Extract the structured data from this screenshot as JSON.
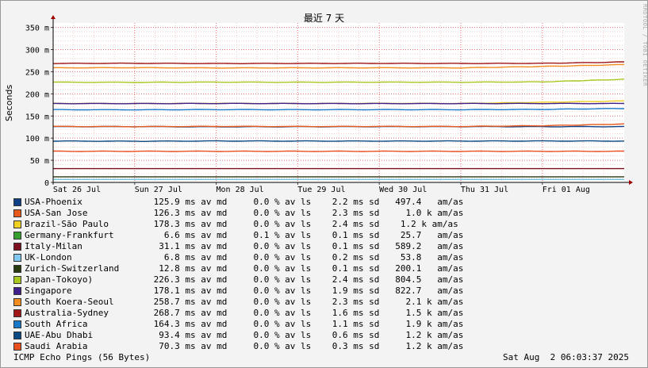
{
  "chart_data": {
    "type": "line",
    "title": "最近 7 天",
    "ylabel": "Seconds",
    "yunit": "m",
    "ylim": [
      0,
      360
    ],
    "yticks": [
      0,
      50,
      100,
      150,
      200,
      250,
      300,
      350
    ],
    "ytick_labels": [
      "0",
      "50 m",
      "100 m",
      "150 m",
      "200 m",
      "250 m",
      "300 m",
      "350 m"
    ],
    "x_categories": [
      "Sat 26 Jul",
      "Sun 27 Jul",
      "Mon 28 Jul",
      "Tue 29 Jul",
      "Wed 30 Jul",
      "Thu 31 Jul",
      "Fri 01 Aug"
    ],
    "grid": true,
    "series": [
      {
        "name": "USA-Phoenix",
        "color": "#0f3f86",
        "values": [
          125.9,
          126,
          125.5,
          125.8,
          125.9,
          126,
          125.9,
          126
        ]
      },
      {
        "name": "USA-San Jose",
        "color": "#e85a1c",
        "values": [
          126.3,
          126,
          126.5,
          126.2,
          126.4,
          126.3,
          128,
          132
        ]
      },
      {
        "name": "Brazil-São Paulo",
        "color": "#f0d020",
        "values": [
          178.3,
          178,
          178.5,
          178,
          178.4,
          178.2,
          181,
          184
        ]
      },
      {
        "name": "Germany-Frankfurt",
        "color": "#35a030",
        "values": [
          6.6,
          6.6,
          6.6,
          6.6,
          6.6,
          6.6,
          6.6,
          6.6
        ]
      },
      {
        "name": "Italy-Milan",
        "color": "#7a1020",
        "values": [
          31.1,
          31.1,
          31.1,
          31.1,
          31.1,
          31.1,
          31.1,
          31.1
        ]
      },
      {
        "name": "UK-London",
        "color": "#80c8f0",
        "values": [
          6.8,
          6.8,
          6.8,
          6.8,
          6.8,
          6.8,
          6.8,
          6.8
        ]
      },
      {
        "name": "Zurich-Switzerland",
        "color": "#2a3a10",
        "values": [
          12.8,
          12.8,
          12.8,
          12.8,
          12.8,
          12.8,
          12.8,
          12.8
        ]
      },
      {
        "name": "Japan-Tokoyo)",
        "color": "#a8c820",
        "values": [
          226.3,
          226,
          226.5,
          226.2,
          226.4,
          226.3,
          227,
          233
        ]
      },
      {
        "name": "Singapore",
        "color": "#40208a",
        "values": [
          178.1,
          178,
          178.2,
          178.1,
          178,
          178.1,
          178.2,
          178.1
        ]
      },
      {
        "name": "South Koera-Seoul",
        "color": "#f08c20",
        "values": [
          258.7,
          259,
          258.5,
          258.7,
          258.8,
          258.6,
          262,
          266
        ]
      },
      {
        "name": "Australia-Sydney",
        "color": "#a01818",
        "values": [
          268.7,
          269,
          268.5,
          268.7,
          268.8,
          268.6,
          268.9,
          272
        ]
      },
      {
        "name": "South Africa",
        "color": "#1878c8",
        "values": [
          164.3,
          164,
          164.5,
          164.2,
          164.4,
          164.3,
          165,
          167
        ]
      },
      {
        "name": "UAE-Abu Dhabi",
        "color": "#0a4a80",
        "values": [
          93.4,
          93,
          93.5,
          93.4,
          93.3,
          93.4,
          93.5,
          93.4
        ]
      },
      {
        "name": "Saudi Arabia",
        "color": "#e85020",
        "values": [
          70.3,
          70.3,
          70.3,
          70.3,
          70.3,
          70.3,
          70.3,
          70.3
        ]
      }
    ]
  },
  "legend": [
    {
      "name": "USA-Phoenix",
      "color": "#0f3f86",
      "stats": "125.9 ms av md     0.0 % av ls    2.2 ms sd   497.4   am/as"
    },
    {
      "name": "USA-San Jose",
      "color": "#e85a1c",
      "stats": "126.3 ms av md     0.0 % av ls    2.3 ms sd     1.0 k am/as"
    },
    {
      "name": "Brazil-São Paulo",
      "color": "#f0d020",
      "stats": "178.3 ms av md     0.0 % av ls    2.4 ms sd    1.2 k am/as"
    },
    {
      "name": "Germany-Frankfurt",
      "color": "#35a030",
      "stats": "6.6 ms av md     0.1 % av ls    0.1 ms sd    25.7   am/as"
    },
    {
      "name": "Italy-Milan",
      "color": "#7a1020",
      "stats": "31.1 ms av md     0.0 % av ls    0.1 ms sd   589.2   am/as"
    },
    {
      "name": "UK-London",
      "color": "#80c8f0",
      "stats": "6.8 ms av md     0.0 % av ls    0.2 ms sd    53.8   am/as"
    },
    {
      "name": "Zurich-Switzerland",
      "color": "#2a3a10",
      "stats": "12.8 ms av md     0.0 % av ls    0.1 ms sd   200.1   am/as"
    },
    {
      "name": "Japan-Tokoyo)",
      "color": "#a8c820",
      "stats": "226.3 ms av md     0.0 % av ls    2.4 ms sd   804.5   am/as"
    },
    {
      "name": "Singapore",
      "color": "#40208a",
      "stats": "178.1 ms av md     0.0 % av ls    1.9 ms sd   822.7   am/as"
    },
    {
      "name": "South Koera-Seoul",
      "color": "#f08c20",
      "stats": "258.7 ms av md     0.0 % av ls    2.3 ms sd     2.1 k am/as"
    },
    {
      "name": "Australia-Sydney",
      "color": "#a01818",
      "stats": "268.7 ms av md     0.0 % av ls    1.6 ms sd     1.5 k am/as"
    },
    {
      "name": "South Africa",
      "color": "#1878c8",
      "stats": "164.3 ms av md     0.0 % av ls    1.1 ms sd     1.9 k am/as"
    },
    {
      "name": "UAE-Abu Dhabi",
      "color": "#0a4a80",
      "stats": "93.4 ms av md     0.0 % av ls    0.6 ms sd     1.2 k am/as"
    },
    {
      "name": "Saudi Arabia",
      "color": "#e85020",
      "stats": "70.3 ms av md     0.0 % av ls    0.3 ms sd     1.2 k am/as"
    }
  ],
  "footer": {
    "left": "ICMP Echo Pings (56 Bytes)",
    "right": "Sat Aug  2 06:03:37 2025"
  },
  "side_label": "RRDTOOL / TOBI OETIKER"
}
